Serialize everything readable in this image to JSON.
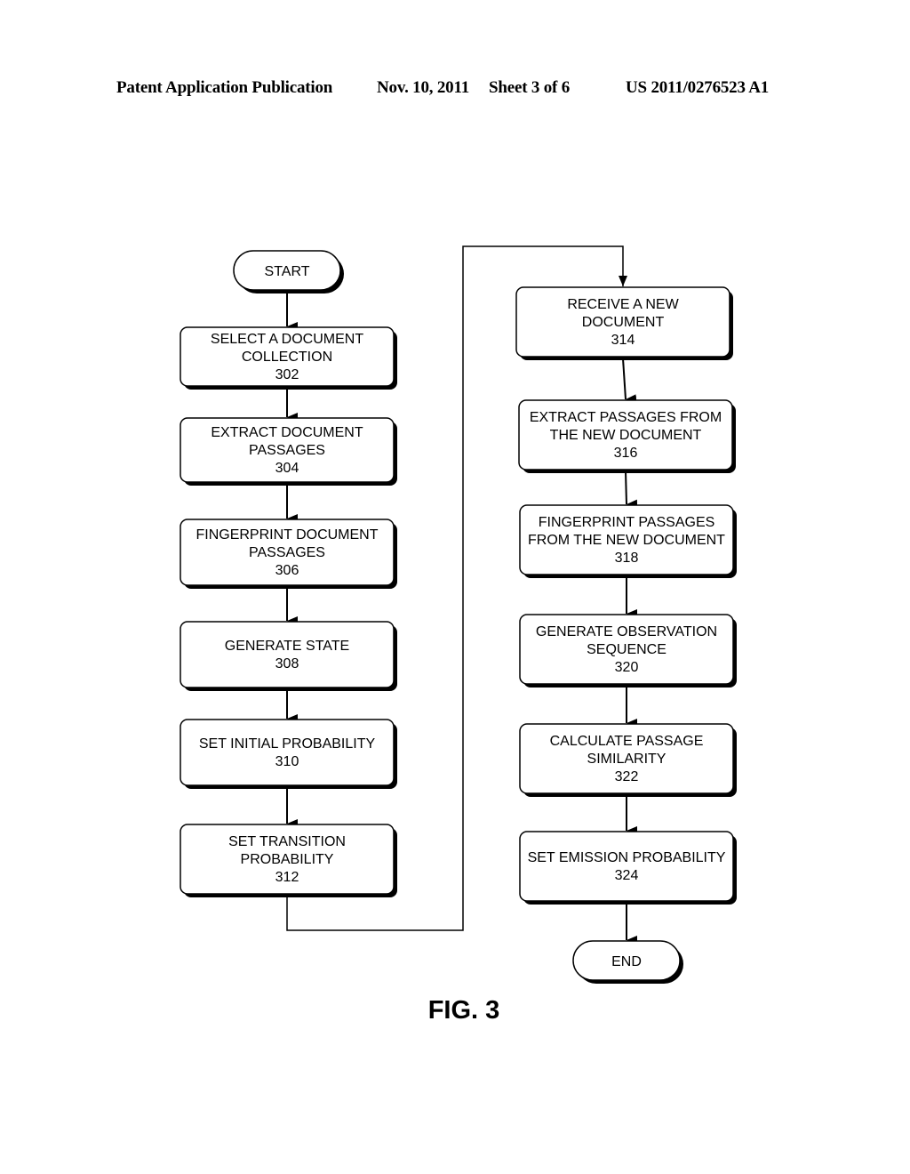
{
  "header": {
    "publication": "Patent Application Publication",
    "date": "Nov. 10, 2011",
    "sheet": "Sheet 3 of 6",
    "number": "US 2011/0276523 A1"
  },
  "figure_label": "FIG. 3",
  "flowchart": {
    "start": "START",
    "end": "END",
    "left_column": [
      {
        "id": "302",
        "lines": [
          "SELECT A DOCUMENT",
          "COLLECTION"
        ]
      },
      {
        "id": "304",
        "lines": [
          "EXTRACT DOCUMENT",
          "PASSAGES"
        ]
      },
      {
        "id": "306",
        "lines": [
          "FINGERPRINT DOCUMENT",
          "PASSAGES"
        ]
      },
      {
        "id": "308",
        "lines": [
          "GENERATE STATE"
        ]
      },
      {
        "id": "310",
        "lines": [
          "SET INITIAL PROBABILITY"
        ]
      },
      {
        "id": "312",
        "lines": [
          "SET TRANSITION",
          "PROBABILITY"
        ]
      }
    ],
    "right_column": [
      {
        "id": "314",
        "lines": [
          "RECEIVE A NEW",
          "DOCUMENT"
        ]
      },
      {
        "id": "316",
        "lines": [
          "EXTRACT PASSAGES FROM",
          "THE NEW DOCUMENT"
        ]
      },
      {
        "id": "318",
        "lines": [
          "FINGERPRINT PASSAGES",
          "FROM THE NEW DOCUMENT"
        ]
      },
      {
        "id": "320",
        "lines": [
          "GENERATE OBSERVATION",
          "SEQUENCE"
        ]
      },
      {
        "id": "322",
        "lines": [
          "CALCULATE PASSAGE",
          "SIMILARITY"
        ]
      },
      {
        "id": "324",
        "lines": [
          "SET EMISSION PROBABILITY"
        ]
      }
    ]
  }
}
